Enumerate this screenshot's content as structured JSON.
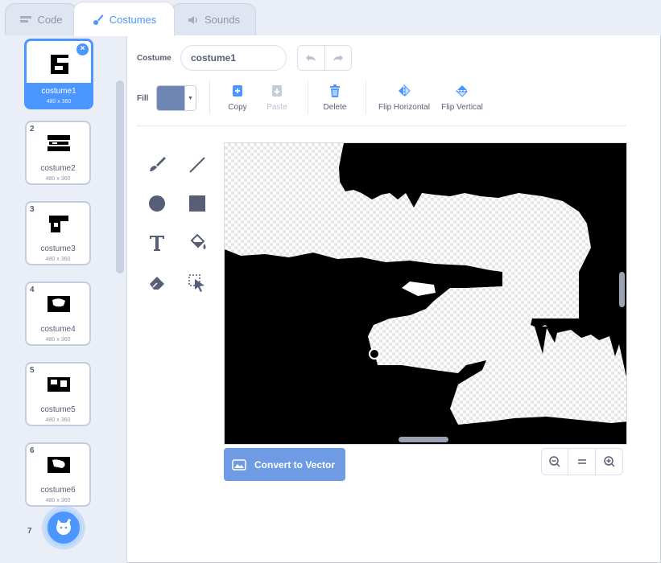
{
  "tabs": [
    {
      "label": "Code",
      "icon": "code-icon"
    },
    {
      "label": "Costumes",
      "icon": "brush-icon"
    },
    {
      "label": "Sounds",
      "icon": "speaker-icon"
    }
  ],
  "costumes": [
    {
      "num": "1",
      "name": "costume1",
      "size": "480 x 360"
    },
    {
      "num": "2",
      "name": "costume2",
      "size": "480 x 360"
    },
    {
      "num": "3",
      "name": "costume3",
      "size": "480 x 360"
    },
    {
      "num": "4",
      "name": "costume4",
      "size": "480 x 360"
    },
    {
      "num": "5",
      "name": "costume5",
      "size": "480 x 360"
    },
    {
      "num": "6",
      "name": "costume6",
      "size": "480 x 360"
    }
  ],
  "partial_costume_num": "7",
  "editor": {
    "costume_label": "Costume",
    "costume_name": "costume1",
    "fill_label": "Fill",
    "fill_color": "#6f86b5",
    "actions": {
      "copy": "Copy",
      "paste": "Paste",
      "delete": "Delete",
      "flip_horizontal": "Flip Horizontal",
      "flip_vertical": "Flip Vertical"
    },
    "convert_label": "Convert to Vector",
    "tools": [
      "brush-icon",
      "line-icon",
      "circle-icon",
      "rectangle-icon",
      "text-icon",
      "fill-bucket-icon",
      "eraser-icon",
      "select-icon"
    ]
  },
  "colors": {
    "accent": "#4c97ff",
    "convert_button": "#6f9be4"
  }
}
